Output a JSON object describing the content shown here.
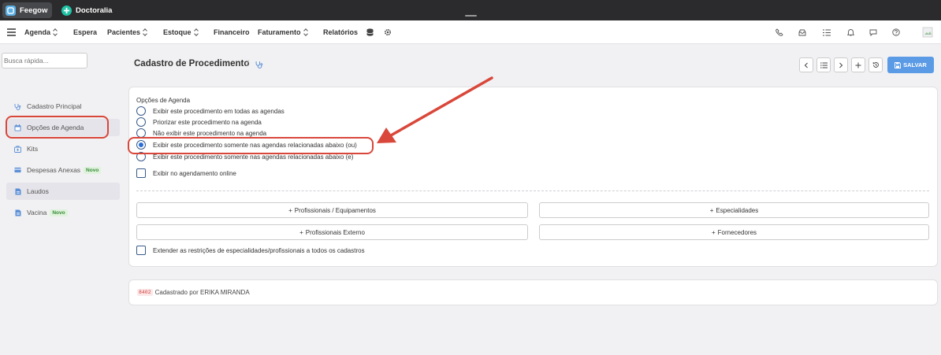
{
  "topbar": {
    "apps": [
      {
        "label": "Feegow",
        "color": "#5ab0e6"
      },
      {
        "label": "Doctoralia",
        "color": "#20c3a6"
      }
    ]
  },
  "nav": {
    "items": [
      "Agenda",
      "Espera",
      "Pacientes",
      "Estoque",
      "Financeiro",
      "Faturamento",
      "Relatórios"
    ]
  },
  "search": {
    "placeholder": "Busca rápida..."
  },
  "sidebar": {
    "items": [
      {
        "label": "Cadastro Principal",
        "icon": "stethoscope-icon"
      },
      {
        "label": "Opções de Agenda",
        "icon": "calendar-icon"
      },
      {
        "label": "Kits",
        "icon": "kit-icon"
      },
      {
        "label": "Despesas Anexas",
        "icon": "card-icon",
        "badge": "Novo"
      },
      {
        "label": "Laudos",
        "icon": "document-icon"
      },
      {
        "label": "Vacina",
        "icon": "document-icon",
        "badge": "Novo"
      }
    ]
  },
  "header": {
    "title": "Cadastro de Procedimento",
    "separator": "/",
    "save_label": "SALVAR"
  },
  "agenda": {
    "section_label": "Opções de Agenda",
    "options": [
      "Exibir este procedimento em todas as agendas",
      "Priorizar este procedimento na agenda",
      "Não exibir este procedimento na agenda",
      "Exibir este procedimento somente nas agendas relacionadas abaixo (ou)",
      "Exibir este procedimento somente nas agendas relacionadas abaixo (e)"
    ],
    "selected": 3,
    "online_label": "Exibir no agendamento online",
    "buttons": [
      "Profissionais / Equipamentos",
      "Especialidades",
      "Profissionais Externo",
      "Fornecedores"
    ],
    "extend_label": "Extender as restrições de especialidades/profissionais a todos os cadastros"
  },
  "footer": {
    "id": "8402",
    "text": "Cadastrado por ERIKA MIRANDA"
  },
  "colors": {
    "accent": "#5b9be6",
    "annotation": "#d9473a"
  }
}
